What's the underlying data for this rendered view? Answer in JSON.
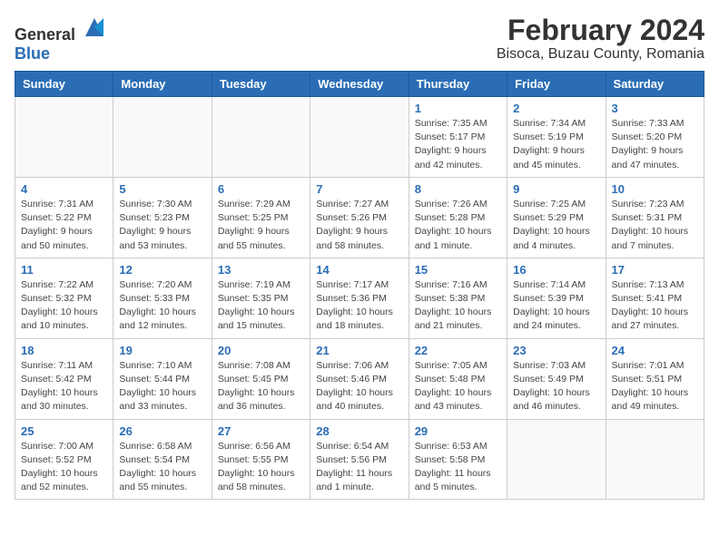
{
  "header": {
    "logo_general": "General",
    "logo_blue": "Blue",
    "main_title": "February 2024",
    "subtitle": "Bisoca, Buzau County, Romania"
  },
  "weekdays": [
    "Sunday",
    "Monday",
    "Tuesday",
    "Wednesday",
    "Thursday",
    "Friday",
    "Saturday"
  ],
  "weeks": [
    [
      {
        "day": "",
        "info": ""
      },
      {
        "day": "",
        "info": ""
      },
      {
        "day": "",
        "info": ""
      },
      {
        "day": "",
        "info": ""
      },
      {
        "day": "1",
        "info": "Sunrise: 7:35 AM\nSunset: 5:17 PM\nDaylight: 9 hours\nand 42 minutes."
      },
      {
        "day": "2",
        "info": "Sunrise: 7:34 AM\nSunset: 5:19 PM\nDaylight: 9 hours\nand 45 minutes."
      },
      {
        "day": "3",
        "info": "Sunrise: 7:33 AM\nSunset: 5:20 PM\nDaylight: 9 hours\nand 47 minutes."
      }
    ],
    [
      {
        "day": "4",
        "info": "Sunrise: 7:31 AM\nSunset: 5:22 PM\nDaylight: 9 hours\nand 50 minutes."
      },
      {
        "day": "5",
        "info": "Sunrise: 7:30 AM\nSunset: 5:23 PM\nDaylight: 9 hours\nand 53 minutes."
      },
      {
        "day": "6",
        "info": "Sunrise: 7:29 AM\nSunset: 5:25 PM\nDaylight: 9 hours\nand 55 minutes."
      },
      {
        "day": "7",
        "info": "Sunrise: 7:27 AM\nSunset: 5:26 PM\nDaylight: 9 hours\nand 58 minutes."
      },
      {
        "day": "8",
        "info": "Sunrise: 7:26 AM\nSunset: 5:28 PM\nDaylight: 10 hours\nand 1 minute."
      },
      {
        "day": "9",
        "info": "Sunrise: 7:25 AM\nSunset: 5:29 PM\nDaylight: 10 hours\nand 4 minutes."
      },
      {
        "day": "10",
        "info": "Sunrise: 7:23 AM\nSunset: 5:31 PM\nDaylight: 10 hours\nand 7 minutes."
      }
    ],
    [
      {
        "day": "11",
        "info": "Sunrise: 7:22 AM\nSunset: 5:32 PM\nDaylight: 10 hours\nand 10 minutes."
      },
      {
        "day": "12",
        "info": "Sunrise: 7:20 AM\nSunset: 5:33 PM\nDaylight: 10 hours\nand 12 minutes."
      },
      {
        "day": "13",
        "info": "Sunrise: 7:19 AM\nSunset: 5:35 PM\nDaylight: 10 hours\nand 15 minutes."
      },
      {
        "day": "14",
        "info": "Sunrise: 7:17 AM\nSunset: 5:36 PM\nDaylight: 10 hours\nand 18 minutes."
      },
      {
        "day": "15",
        "info": "Sunrise: 7:16 AM\nSunset: 5:38 PM\nDaylight: 10 hours\nand 21 minutes."
      },
      {
        "day": "16",
        "info": "Sunrise: 7:14 AM\nSunset: 5:39 PM\nDaylight: 10 hours\nand 24 minutes."
      },
      {
        "day": "17",
        "info": "Sunrise: 7:13 AM\nSunset: 5:41 PM\nDaylight: 10 hours\nand 27 minutes."
      }
    ],
    [
      {
        "day": "18",
        "info": "Sunrise: 7:11 AM\nSunset: 5:42 PM\nDaylight: 10 hours\nand 30 minutes."
      },
      {
        "day": "19",
        "info": "Sunrise: 7:10 AM\nSunset: 5:44 PM\nDaylight: 10 hours\nand 33 minutes."
      },
      {
        "day": "20",
        "info": "Sunrise: 7:08 AM\nSunset: 5:45 PM\nDaylight: 10 hours\nand 36 minutes."
      },
      {
        "day": "21",
        "info": "Sunrise: 7:06 AM\nSunset: 5:46 PM\nDaylight: 10 hours\nand 40 minutes."
      },
      {
        "day": "22",
        "info": "Sunrise: 7:05 AM\nSunset: 5:48 PM\nDaylight: 10 hours\nand 43 minutes."
      },
      {
        "day": "23",
        "info": "Sunrise: 7:03 AM\nSunset: 5:49 PM\nDaylight: 10 hours\nand 46 minutes."
      },
      {
        "day": "24",
        "info": "Sunrise: 7:01 AM\nSunset: 5:51 PM\nDaylight: 10 hours\nand 49 minutes."
      }
    ],
    [
      {
        "day": "25",
        "info": "Sunrise: 7:00 AM\nSunset: 5:52 PM\nDaylight: 10 hours\nand 52 minutes."
      },
      {
        "day": "26",
        "info": "Sunrise: 6:58 AM\nSunset: 5:54 PM\nDaylight: 10 hours\nand 55 minutes."
      },
      {
        "day": "27",
        "info": "Sunrise: 6:56 AM\nSunset: 5:55 PM\nDaylight: 10 hours\nand 58 minutes."
      },
      {
        "day": "28",
        "info": "Sunrise: 6:54 AM\nSunset: 5:56 PM\nDaylight: 11 hours\nand 1 minute."
      },
      {
        "day": "29",
        "info": "Sunrise: 6:53 AM\nSunset: 5:58 PM\nDaylight: 11 hours\nand 5 minutes."
      },
      {
        "day": "",
        "info": ""
      },
      {
        "day": "",
        "info": ""
      }
    ]
  ]
}
